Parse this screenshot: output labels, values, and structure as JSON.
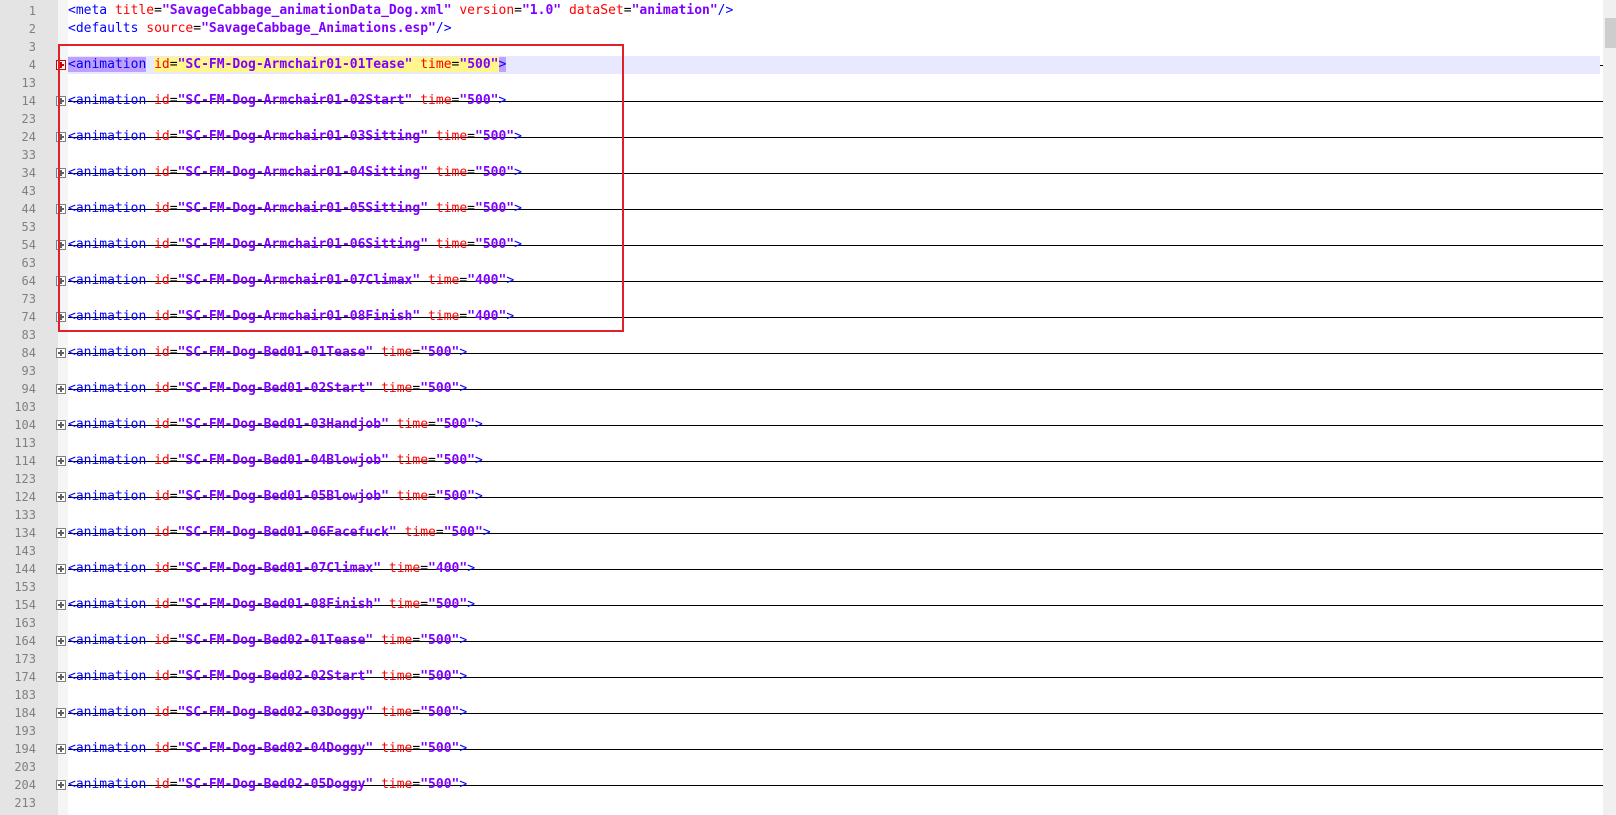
{
  "editor": {
    "lines": [
      {
        "num": "1",
        "fold": false,
        "parts": [
          [
            "t",
            "<meta "
          ],
          [
            "a",
            "title"
          ],
          [
            "e",
            "="
          ],
          [
            "v",
            "\"SavageCabbage_animationData_Dog.xml\""
          ],
          [
            "t",
            " "
          ],
          [
            "a",
            "version"
          ],
          [
            "e",
            "="
          ],
          [
            "v",
            "\"1.0\""
          ],
          [
            "t",
            " "
          ],
          [
            "a",
            "dataSet"
          ],
          [
            "e",
            "="
          ],
          [
            "v",
            "\"animation\""
          ],
          [
            "t",
            "/>"
          ]
        ]
      },
      {
        "num": "2",
        "fold": false,
        "parts": [
          [
            "t",
            "<defaults "
          ],
          [
            "a",
            "source"
          ],
          [
            "e",
            "="
          ],
          [
            "v",
            "\"SavageCabbage_Animations.esp\""
          ],
          [
            "t",
            "/>"
          ]
        ]
      },
      {
        "num": "3",
        "fold": false,
        "parts": []
      },
      {
        "num": "4",
        "fold": true,
        "current": true,
        "id": "SC-FM-Dog-Armchair01-01Tease",
        "time": "500"
      },
      {
        "num": "13",
        "fold": false,
        "parts": []
      },
      {
        "num": "14",
        "fold": true,
        "id": "SC-FM-Dog-Armchair01-02Start",
        "time": "500"
      },
      {
        "num": "23",
        "fold": false,
        "parts": []
      },
      {
        "num": "24",
        "fold": true,
        "id": "SC-FM-Dog-Armchair01-03Sitting",
        "time": "500"
      },
      {
        "num": "33",
        "fold": false,
        "parts": []
      },
      {
        "num": "34",
        "fold": true,
        "id": "SC-FM-Dog-Armchair01-04Sitting",
        "time": "500"
      },
      {
        "num": "43",
        "fold": false,
        "parts": []
      },
      {
        "num": "44",
        "fold": true,
        "id": "SC-FM-Dog-Armchair01-05Sitting",
        "time": "500"
      },
      {
        "num": "53",
        "fold": false,
        "parts": []
      },
      {
        "num": "54",
        "fold": true,
        "id": "SC-FM-Dog-Armchair01-06Sitting",
        "time": "500"
      },
      {
        "num": "63",
        "fold": false,
        "parts": []
      },
      {
        "num": "64",
        "fold": true,
        "id": "SC-FM-Dog-Armchair01-07Climax",
        "time": "400"
      },
      {
        "num": "73",
        "fold": false,
        "parts": []
      },
      {
        "num": "74",
        "fold": true,
        "id": "SC-FM-Dog-Armchair01-08Finish",
        "time": "400"
      },
      {
        "num": "83",
        "fold": false,
        "parts": []
      },
      {
        "num": "84",
        "fold": true,
        "id": "SC-FM-Dog-Bed01-01Tease",
        "time": "500"
      },
      {
        "num": "93",
        "fold": false,
        "parts": []
      },
      {
        "num": "94",
        "fold": true,
        "id": "SC-FM-Dog-Bed01-02Start",
        "time": "500"
      },
      {
        "num": "103",
        "fold": false,
        "parts": []
      },
      {
        "num": "104",
        "fold": true,
        "id": "SC-FM-Dog-Bed01-03Handjob",
        "time": "500"
      },
      {
        "num": "113",
        "fold": false,
        "parts": []
      },
      {
        "num": "114",
        "fold": true,
        "id": "SC-FM-Dog-Bed01-04Blowjob",
        "time": "500"
      },
      {
        "num": "123",
        "fold": false,
        "parts": []
      },
      {
        "num": "124",
        "fold": true,
        "id": "SC-FM-Dog-Bed01-05Blowjob",
        "time": "500"
      },
      {
        "num": "133",
        "fold": false,
        "parts": []
      },
      {
        "num": "134",
        "fold": true,
        "id": "SC-FM-Dog-Bed01-06Facefuck",
        "time": "500"
      },
      {
        "num": "143",
        "fold": false,
        "parts": []
      },
      {
        "num": "144",
        "fold": true,
        "id": "SC-FM-Dog-Bed01-07Climax",
        "time": "400"
      },
      {
        "num": "153",
        "fold": false,
        "parts": []
      },
      {
        "num": "154",
        "fold": true,
        "id": "SC-FM-Dog-Bed01-08Finish",
        "time": "500"
      },
      {
        "num": "163",
        "fold": false,
        "parts": []
      },
      {
        "num": "164",
        "fold": true,
        "id": "SC-FM-Dog-Bed02-01Tease",
        "time": "500"
      },
      {
        "num": "173",
        "fold": false,
        "parts": []
      },
      {
        "num": "174",
        "fold": true,
        "id": "SC-FM-Dog-Bed02-02Start",
        "time": "500"
      },
      {
        "num": "183",
        "fold": false,
        "parts": []
      },
      {
        "num": "184",
        "fold": true,
        "id": "SC-FM-Dog-Bed02-03Doggy",
        "time": "500"
      },
      {
        "num": "193",
        "fold": false,
        "parts": []
      },
      {
        "num": "194",
        "fold": true,
        "id": "SC-FM-Dog-Bed02-04Doggy",
        "time": "500"
      },
      {
        "num": "203",
        "fold": false,
        "parts": []
      },
      {
        "num": "204",
        "fold": true,
        "id": "SC-FM-Dog-Bed02-05Doggy",
        "time": "500"
      },
      {
        "num": "213",
        "fold": false,
        "parts": []
      }
    ],
    "colors": {
      "tag": "#0000ff",
      "attr": "#ff0000",
      "value": "#8000ff",
      "selection_box": "#e0202a",
      "current_line": "#e8e8ff"
    },
    "icons": {
      "fold": "fold-plus-icon"
    }
  }
}
